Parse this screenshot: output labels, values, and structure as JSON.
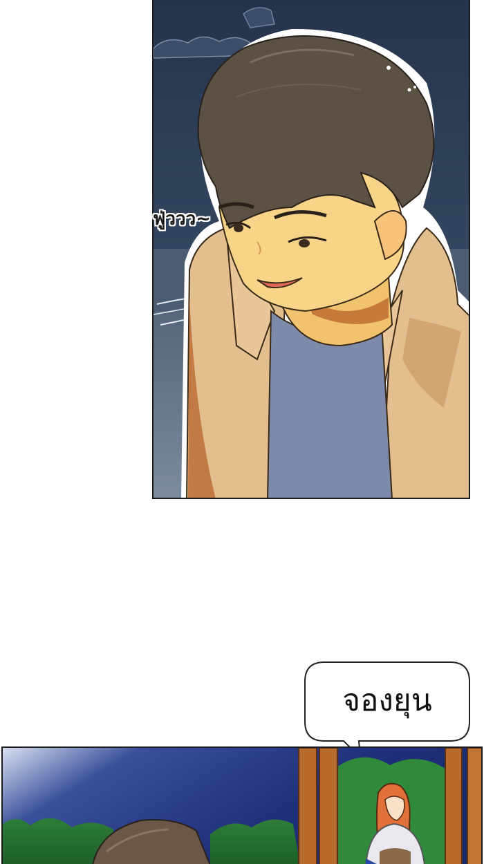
{
  "panel1": {
    "sfx_text": "ฟู่ววว~"
  },
  "speech_bubble": {
    "text": "จองยุน"
  },
  "colors": {
    "night_sky": "#2d3d57",
    "jacket": "#e3bf8f",
    "shirt": "#7d8aaa",
    "hair": "#5b5145",
    "skin": "#f7d488"
  }
}
